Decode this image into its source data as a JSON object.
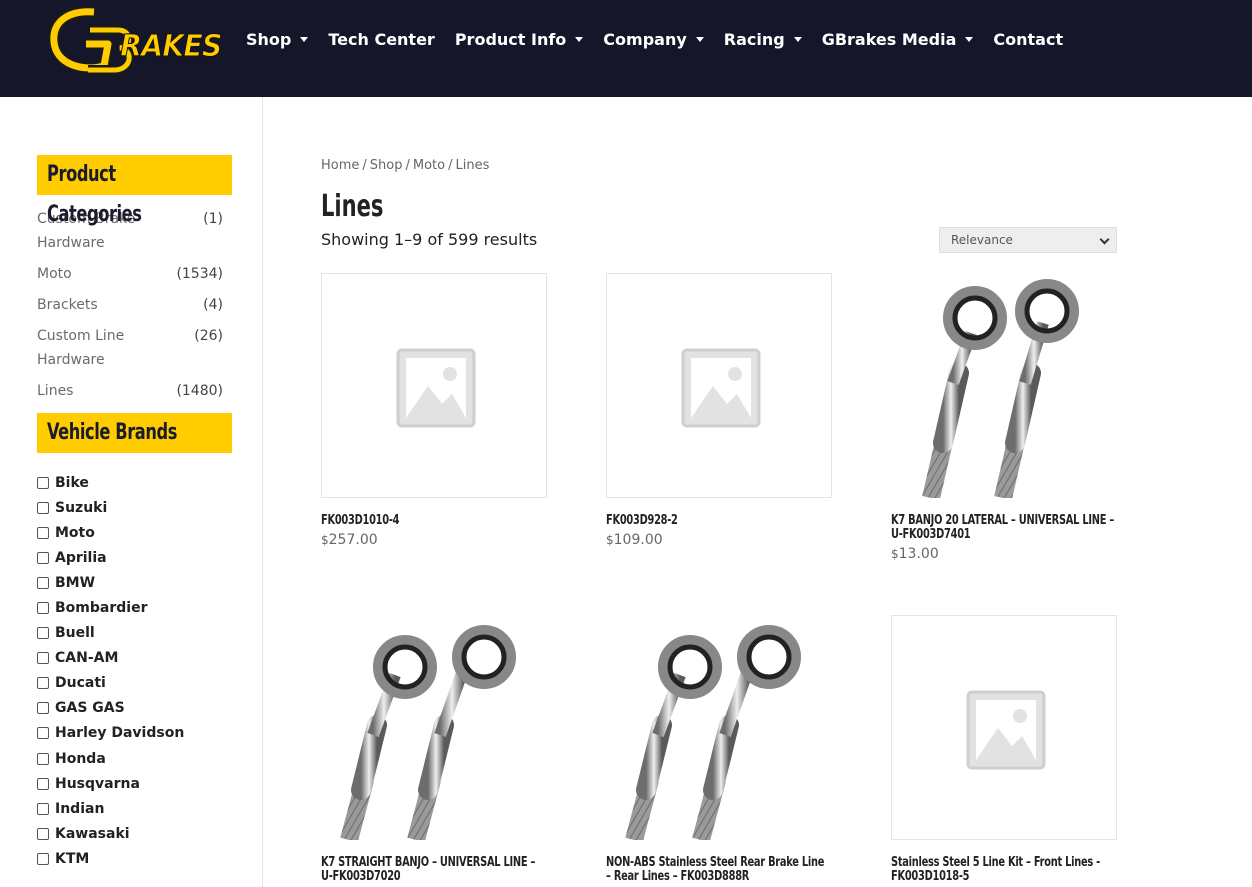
{
  "header": {
    "logo_text": "GBRAKES",
    "nav": [
      {
        "label": "Shop",
        "has_dropdown": true
      },
      {
        "label": "Tech Center",
        "has_dropdown": false
      },
      {
        "label": "Product Info",
        "has_dropdown": true
      },
      {
        "label": "Company",
        "has_dropdown": true
      },
      {
        "label": "Racing",
        "has_dropdown": true
      },
      {
        "label": "GBrakes Media",
        "has_dropdown": true
      },
      {
        "label": "Contact",
        "has_dropdown": false
      }
    ]
  },
  "sidebar": {
    "categories_title": "Product Categories",
    "categories": [
      {
        "name": "Custom Brake Hardware",
        "count": "(1)"
      },
      {
        "name": "Moto",
        "count": "(1534)"
      },
      {
        "name": "Brackets",
        "count": "(4)"
      },
      {
        "name": "Custom Line Hardware",
        "count": "(26)"
      },
      {
        "name": "Lines",
        "count": "(1480)"
      }
    ],
    "brands_title": "Vehicle Brands",
    "brands": [
      "Bike",
      "Suzuki",
      "Moto",
      "Aprilia",
      "BMW",
      "Bombardier",
      "Buell",
      "CAN-AM",
      "Ducati",
      "GAS GAS",
      "Harley Davidson",
      "Honda",
      "Husqvarna",
      "Indian",
      "Kawasaki",
      "KTM"
    ]
  },
  "main": {
    "breadcrumb": [
      "Home",
      "Shop",
      "Moto",
      "Lines"
    ],
    "breadcrumb_sep": "/",
    "title": "Lines",
    "results_text": "Showing 1–9 of 599 results",
    "sort_selected": "Relevance",
    "currency": "$",
    "products": [
      {
        "title": "FK003D1010-4",
        "price": "257.00",
        "image": "placeholder-icon"
      },
      {
        "title": "FK003D928-2",
        "price": "109.00",
        "image": "placeholder-icon"
      },
      {
        "title": "K7 BANJO 20 LATERAL – UNIVERSAL LINE – U-FK003D7401",
        "price": "13.00",
        "image": "brake-line-photo"
      },
      {
        "title": "K7 STRAIGHT BANJO – UNIVERSAL LINE – U-FK003D7020",
        "price": "",
        "image": "brake-line-photo"
      },
      {
        "title": "NON-ABS Stainless Steel Rear Brake Line – Rear Lines – FK003D888R",
        "price": "",
        "image": "brake-line-photo"
      },
      {
        "title": "Stainless Steel 5 Line Kit – Front Lines - FK003D1018-5",
        "price": "",
        "image": "placeholder-icon"
      }
    ]
  },
  "colors": {
    "header_bg": "#16162b",
    "accent_yellow": "#ffcc00"
  }
}
